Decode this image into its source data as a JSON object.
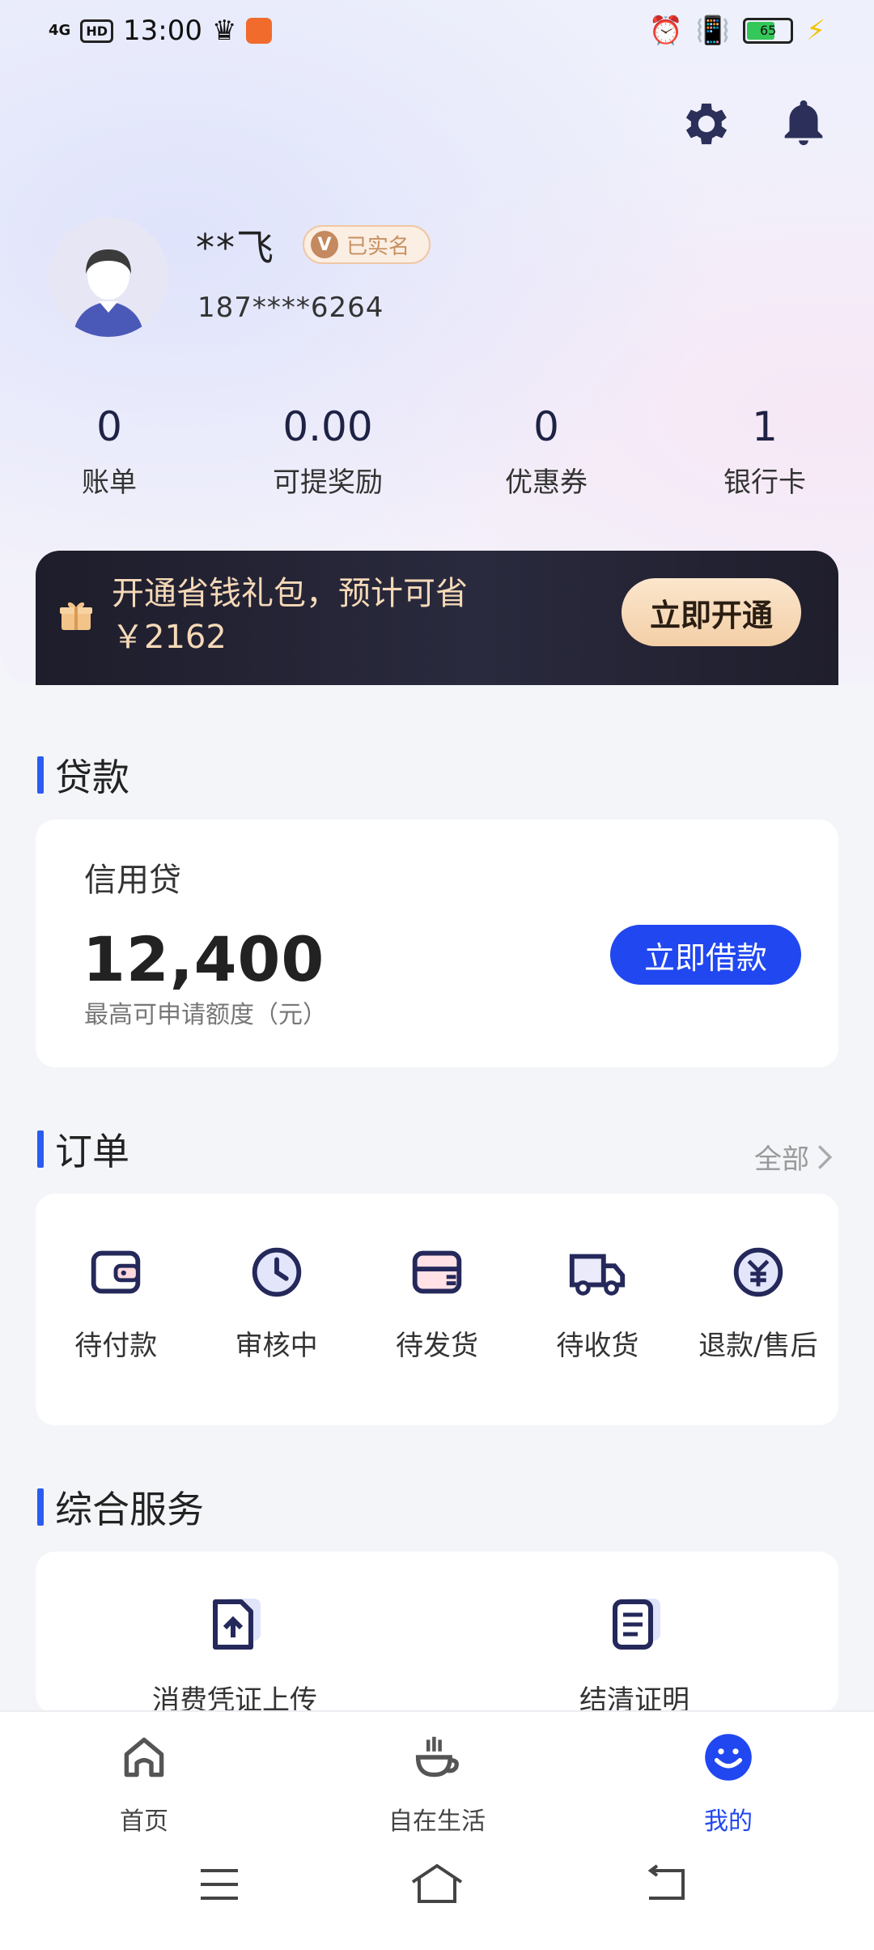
{
  "status_bar": {
    "network": "4G",
    "hd": "HD",
    "time": "13:00",
    "battery": "65"
  },
  "profile": {
    "name": "**飞",
    "verified_badge": "V",
    "verified_label": "已实名",
    "phone": "187****6264"
  },
  "stats": [
    {
      "value": "0",
      "label": "账单"
    },
    {
      "value": "0.00",
      "label": "可提奖励"
    },
    {
      "value": "0",
      "label": "优惠券"
    },
    {
      "value": "1",
      "label": "银行卡"
    }
  ],
  "promo": {
    "line1": "开通省钱礼包，预计可省",
    "line2": "￥2162",
    "button": "立即开通"
  },
  "loan": {
    "section_title": "贷款",
    "product": "信用贷",
    "amount": "12,400",
    "subtitle": "最高可申请额度（元）",
    "button": "立即借款"
  },
  "orders": {
    "section_title": "订单",
    "all_label": "全部",
    "items": [
      {
        "label": "待付款",
        "icon": "wallet-icon"
      },
      {
        "label": "审核中",
        "icon": "clock-icon"
      },
      {
        "label": "待发货",
        "icon": "package-icon"
      },
      {
        "label": "待收货",
        "icon": "truck-icon"
      },
      {
        "label": "退款/售后",
        "icon": "refund-icon"
      }
    ]
  },
  "services": {
    "section_title": "综合服务",
    "items": [
      {
        "label": "消费凭证上传",
        "icon": "upload-document-icon"
      },
      {
        "label": "结清证明",
        "icon": "document-icon"
      }
    ]
  },
  "tabbar": {
    "items": [
      {
        "label": "首页",
        "icon": "home-icon",
        "active": false
      },
      {
        "label": "自在生活",
        "icon": "coffee-icon",
        "active": false
      },
      {
        "label": "我的",
        "icon": "smile-icon",
        "active": true
      }
    ]
  },
  "colors": {
    "accent": "#2147f0",
    "promo_gold": "#f5d9b7",
    "section_bar": "#2b5cf0"
  }
}
